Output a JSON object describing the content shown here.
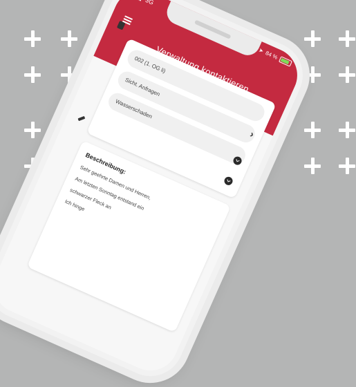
{
  "status_bar": {
    "network": "3G",
    "battery": "84 %",
    "battery_level": 0.84
  },
  "header": {
    "title": "Verwaltung kontaktieren"
  },
  "form": {
    "unit_value": "002 (1. OG li)",
    "category_value": "Sicht. Anfragen",
    "subcategory_value": "Wasserschaden"
  },
  "description": {
    "label": "Beschreibung:",
    "lines": [
      "Sehr geehrte Damen und Herren,",
      "Am letzten Sonntag entstand ein",
      "schwarzer Fleck an",
      "Ich hinge"
    ]
  },
  "colors": {
    "brand_red": "#c42a40",
    "background": "#b4b5b5"
  }
}
